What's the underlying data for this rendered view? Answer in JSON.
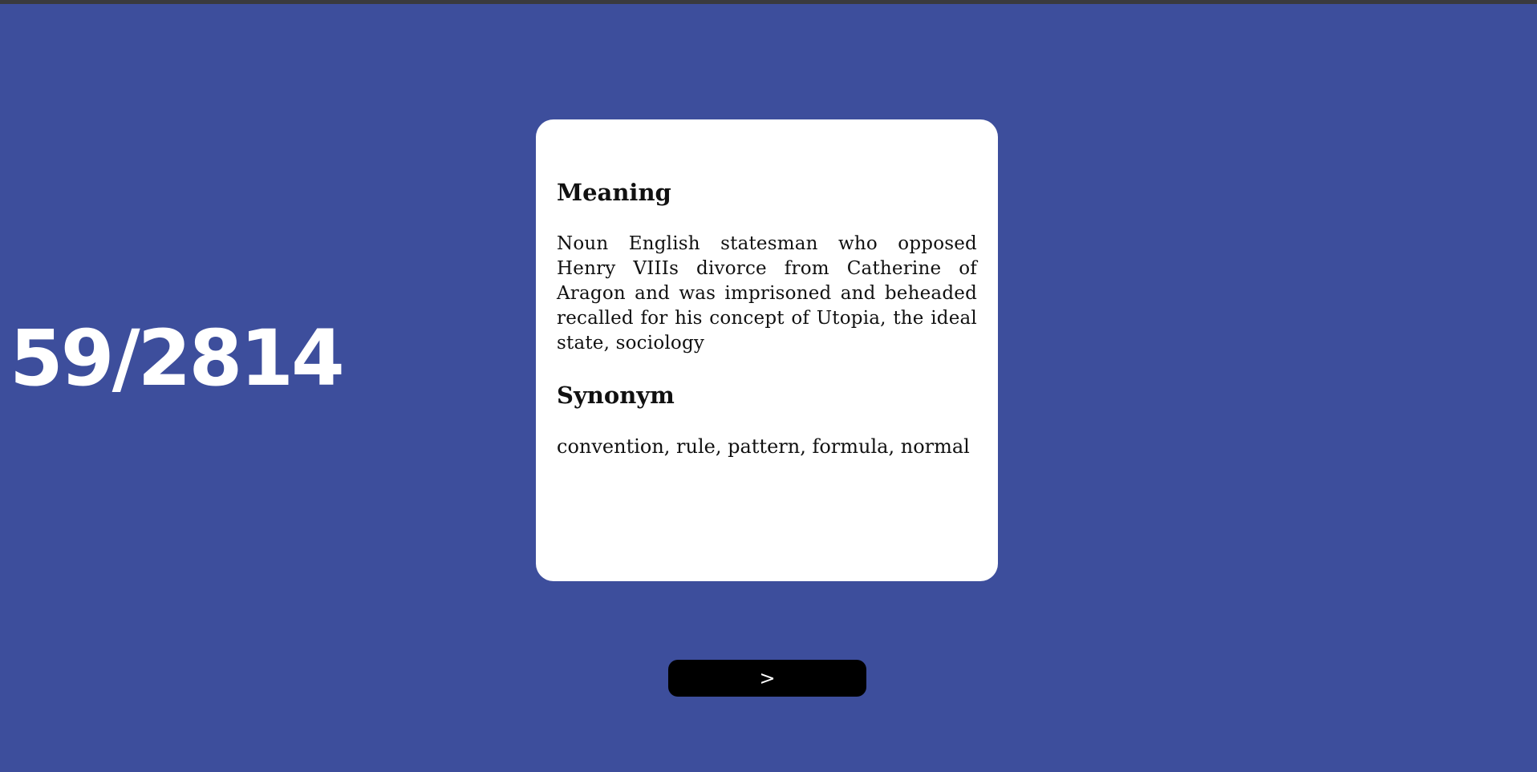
{
  "progress": {
    "counter": "59/2814"
  },
  "card": {
    "meaning_heading": "Meaning",
    "meaning_text": "Noun English statesman who opposed Henry VIIIs divorce from Catherine of Aragon and was imprisoned and beheaded recalled for his concept of Utopia, the ideal state, sociology",
    "synonym_heading": "Synonym",
    "synonym_text": "convention, rule, pattern, formula, normal"
  },
  "navigation": {
    "next_label": ">"
  },
  "colors": {
    "background": "#3d4e9c",
    "card": "#ffffff",
    "button": "#000000",
    "text_light": "#ffffff"
  }
}
